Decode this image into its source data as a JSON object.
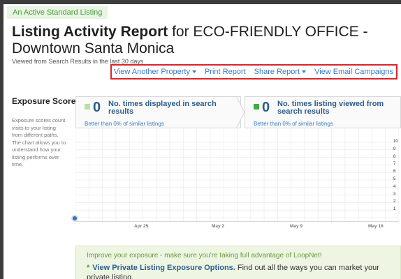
{
  "header": {
    "active_tag": "An Active Standard Listing",
    "title_bold": "Listing Activity Report",
    "title_rest": " for ECO-FRIENDLY OFFICE - Downtown Santa Monica",
    "subtitle": "Viewed from Search Results in the last 30 days"
  },
  "actions": {
    "view_another": "View Another Property",
    "print": "Print Report",
    "share": "Share Report",
    "email": "View Email Campaigns"
  },
  "sidebar": {
    "title": "Exposure Scores",
    "description": "Exposure scores count visits to your listing from different paths. The chart allows you to understand how your listing performs over time."
  },
  "cards": [
    {
      "count": "0",
      "label": "No. times displayed in search results",
      "sub": "Better than 0% of similar listings",
      "color": "#b7e0a8"
    },
    {
      "count": "0",
      "label": "No. times listing viewed from search results",
      "sub": "Better than 0% of similar listings",
      "color": "#3fae3f"
    }
  ],
  "chart_data": {
    "type": "line",
    "x_tick_labels": [
      "Apr 25",
      "May 2",
      "May 9",
      "May 16"
    ],
    "y_tick_labels": [
      "10",
      "9",
      "8",
      "7",
      "6",
      "5",
      "4",
      "3",
      "2",
      "1"
    ],
    "ylim": [
      0,
      10
    ],
    "grid": true,
    "series": []
  },
  "banner": {
    "intro": "Improve your exposure - make sure you're taking full advantage of LoopNet!",
    "link": "View Private Listing Exposure Options.",
    "text": " Find out all the ways you can market your private listing."
  }
}
